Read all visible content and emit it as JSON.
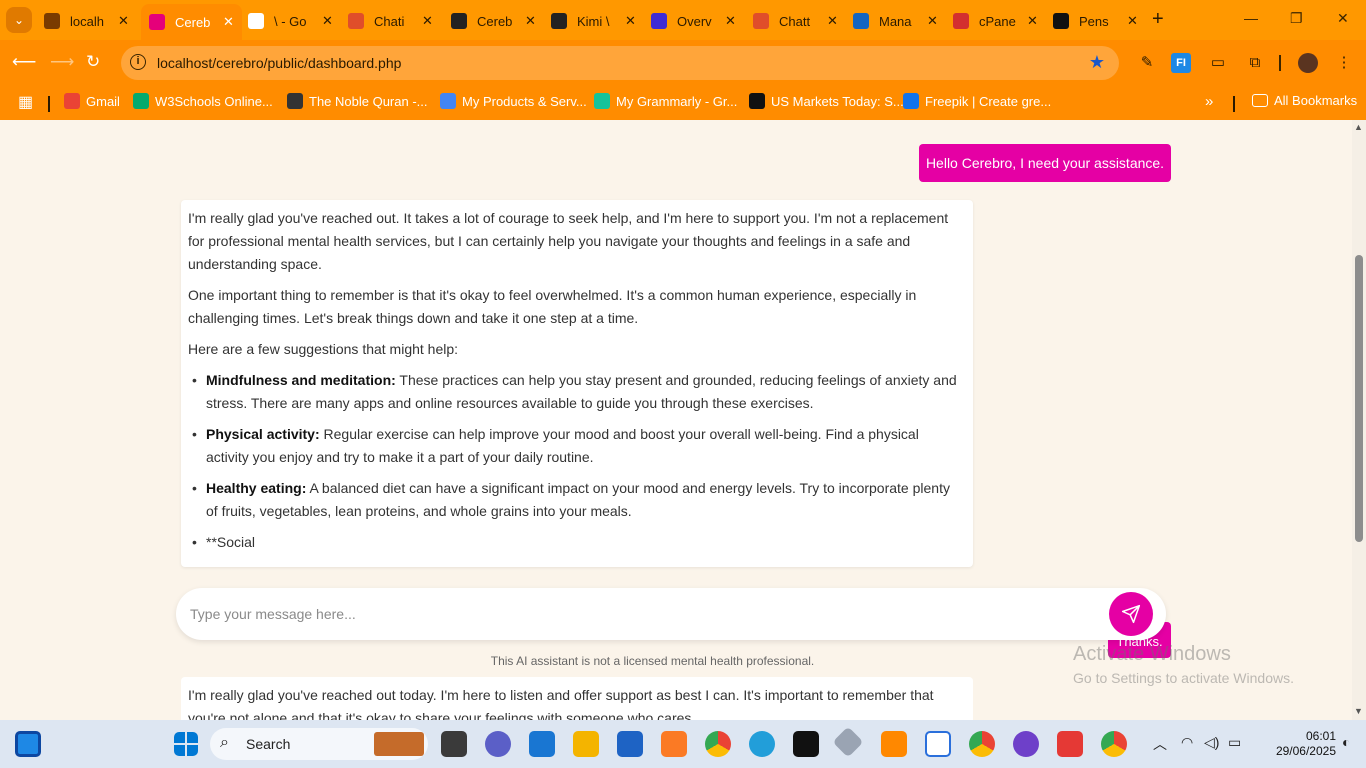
{
  "browser": {
    "tabs": [
      {
        "title": "localh",
        "favicon": "chart-icon",
        "color": "#7a3b00"
      },
      {
        "title": "Cereb",
        "favicon": "brain-icon",
        "color": "#e5007a",
        "active": true
      },
      {
        "title": "\\ - Go",
        "favicon": "google-icon",
        "color": "#ffffff"
      },
      {
        "title": "Chati",
        "favicon": "figma-icon",
        "color": "#e04e2a"
      },
      {
        "title": "Cereb",
        "favicon": "openai-icon",
        "color": "#222222"
      },
      {
        "title": "Kimi \\",
        "favicon": "kimi-icon",
        "color": "#222222"
      },
      {
        "title": "Overv",
        "favicon": "overview-icon",
        "color": "#3f2bd6"
      },
      {
        "title": "Chatt",
        "favicon": "figma-icon",
        "color": "#e04e2a"
      },
      {
        "title": "Mana",
        "favicon": "manage-icon",
        "color": "#1565c0"
      },
      {
        "title": "cPane",
        "favicon": "cpanel-icon",
        "color": "#d32f2f"
      },
      {
        "title": "Pens",
        "favicon": "codepen-icon",
        "color": "#111111"
      }
    ],
    "close_glyph": "✕",
    "new_tab_glyph": "+",
    "url": "localhost/cerebro/public/dashboard.php",
    "bookmarks": [
      {
        "label": "Gmail",
        "favicon": "gmail-icon",
        "color": "#ea4335"
      },
      {
        "label": "W3Schools Online...",
        "favicon": "w3schools-icon",
        "color": "#04aa6d"
      },
      {
        "label": "The Noble Quran -...",
        "favicon": "quran-icon",
        "color": "#333333"
      },
      {
        "label": "My Products & Serv...",
        "favicon": "products-icon",
        "color": "#4285f4"
      },
      {
        "label": "My Grammarly - Gr...",
        "favicon": "grammarly-icon",
        "color": "#15c39a"
      },
      {
        "label": "US Markets Today: S...",
        "favicon": "tradingview-icon",
        "color": "#111111"
      },
      {
        "label": "Freepik | Create gre...",
        "favicon": "freepik-icon",
        "color": "#1273eb"
      }
    ],
    "all_bookmarks_label": "All Bookmarks",
    "accent_color": "#ff8c00"
  },
  "chat": {
    "user_message": "Hello Cerebro, I need your assistance.",
    "bot_paragraphs": [
      "I'm really glad you've reached out. It takes a lot of courage to seek help, and I'm here to support you. I'm not a replacement for professional mental health services, but I can certainly help you navigate your thoughts and feelings in a safe and understanding space.",
      "One important thing to remember is that it's okay to feel overwhelmed. It's a common human experience, especially in challenging times. Let's break things down and take it one step at a time.",
      "Here are a few suggestions that might help:"
    ],
    "suggestions": [
      {
        "title": "Mindfulness and meditation:",
        "text": " These practices can help you stay present and grounded, reducing feelings of anxiety and stress. There are many apps and online resources available to guide you through these exercises."
      },
      {
        "title": "Physical activity:",
        "text": " Regular exercise can help improve your mood and boost your overall well-being. Find a physical activity you enjoy and try to make it a part of your daily routine."
      },
      {
        "title": "Healthy eating:",
        "text": " A balanced diet can have a significant impact on your mood and energy levels. Try to incorporate plenty of fruits, vegetables, lean proteins, and whole grains into your meals."
      },
      {
        "title": "",
        "text": "**Social"
      }
    ],
    "input_placeholder": "Type your message here...",
    "peek_user_message": "Thanks.",
    "disclaimer": "This AI assistant is not a licensed mental health professional.",
    "second_bot_message": "I'm really glad you've reached out today. I'm here to listen and offer support as best I can. It's important to remember that you're not alone and that it's okay to share your feelings with someone who cares.",
    "accent_color": "#e500a4"
  },
  "watermark": {
    "line1": "Activate Windows",
    "line2": "Go to Settings to activate Windows."
  },
  "taskbar": {
    "search_label": "Search",
    "time": "06:01",
    "date": "29/06/2025"
  }
}
